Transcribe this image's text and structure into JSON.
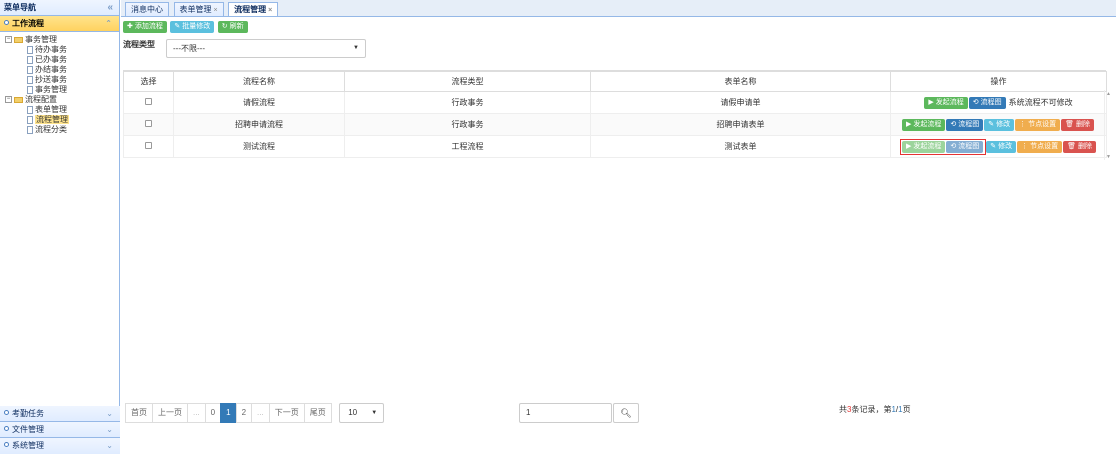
{
  "sidebar": {
    "title": "菜单导航",
    "collapse_icon": "«",
    "active_section": "工作流程",
    "tree": {
      "group1": "事务管理",
      "group1_items": [
        "待办事务",
        "已办事务",
        "办结事务",
        "抄送事务",
        "事务管理"
      ],
      "group2": "流程配置",
      "group2_items": [
        "表单管理",
        "流程管理",
        "流程分类"
      ]
    },
    "bottom_sections": [
      "考勤任务",
      "文件管理",
      "系统管理"
    ]
  },
  "tabs": [
    "消息中心",
    "表单管理",
    "流程管理"
  ],
  "toolbar": {
    "add": "添加流程",
    "batch_edit": "批量修改",
    "refresh": "刷新"
  },
  "filter": {
    "label": "流程类型",
    "value": "---不限---"
  },
  "grid": {
    "columns": [
      "选择",
      "流程名称",
      "流程类型",
      "表单名称",
      "操作"
    ],
    "rows": [
      {
        "name": "请假流程",
        "type": "行政事务",
        "form": "请假申请单"
      },
      {
        "name": "招聘申请流程",
        "type": "行政事务",
        "form": "招聘申请表单"
      },
      {
        "name": "测试流程",
        "type": "工程流程",
        "form": "测试表单"
      }
    ],
    "op_labels": {
      "start": "发起流程",
      "diagram": "流程图",
      "edit": "修改",
      "node": "节点设置",
      "delete": "删除",
      "no_edit_note": "系统流程不可修改"
    }
  },
  "pager": {
    "first": "首页",
    "prev": "上一页",
    "ellipsis": "...",
    "pages": [
      "0",
      "1",
      "2"
    ],
    "current": "1",
    "next": "下一页",
    "last": "尾页",
    "page_size": "10",
    "jump_value": "1",
    "summary_prefix": "共",
    "summary_total": "3",
    "summary_mid": "条记录，第",
    "summary_page": "1",
    "summary_sep": "/",
    "summary_pages": "1",
    "summary_suffix": "页"
  },
  "colors": {
    "green": "#5cb85c",
    "blue": "#5bc0de",
    "navy": "#337ab7",
    "orange": "#f0ad4e",
    "red": "#d9534f",
    "highlight_border": "#e53333"
  }
}
